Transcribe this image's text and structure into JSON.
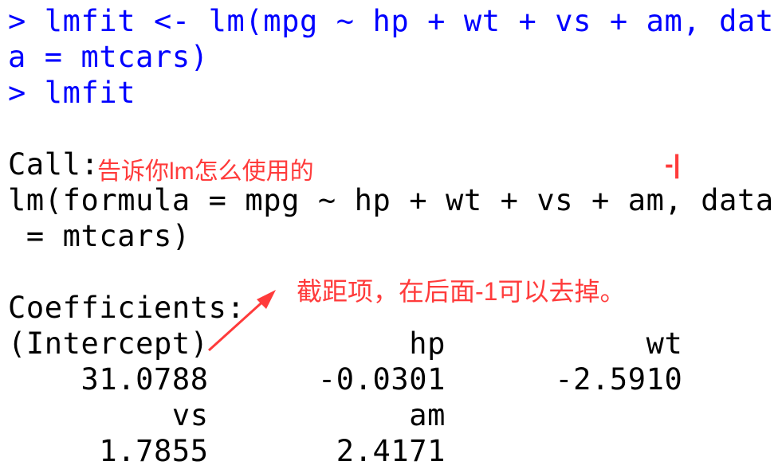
{
  "console_lines": [
    {
      "text": "> lmfit <- lm(mpg ~ hp + wt + vs + am, dat",
      "type": "in"
    },
    {
      "text": "a = mtcars)",
      "type": "in"
    },
    {
      "text": "> lmfit",
      "type": "in"
    },
    {
      "text": "",
      "type": "out"
    },
    {
      "text": "Call:",
      "type": "out"
    },
    {
      "text": "lm(formula = mpg ~ hp + wt + vs + am, data",
      "type": "out"
    },
    {
      "text": " = mtcars)",
      "type": "out"
    },
    {
      "text": "",
      "type": "out"
    },
    {
      "text": "Coefficients:",
      "type": "out"
    },
    {
      "text": "(Intercept)           hp           wt",
      "type": "out"
    },
    {
      "text": "    31.0788      -0.0301      -2.5910",
      "type": "out"
    },
    {
      "text": "         vs           am",
      "type": "out"
    },
    {
      "text": "     1.7855       2.4171",
      "type": "out"
    }
  ],
  "annotations": {
    "call_note": "告诉你lm怎么使用的",
    "minus_one_mark": "-|",
    "intercept_note": "截距项，在后面-1可以去掉。"
  },
  "colors": {
    "input": "#0000ff",
    "annotation": "#ff3b3b"
  }
}
